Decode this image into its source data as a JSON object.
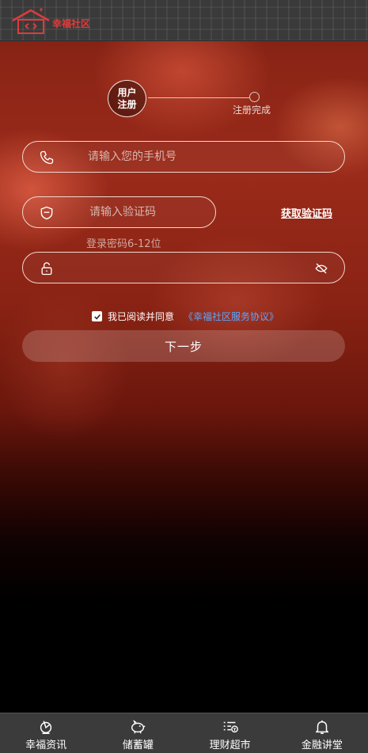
{
  "header": {
    "logo_text": "幸福社区"
  },
  "stepper": {
    "step1_label": "用户注册",
    "step2_label": "注册完成"
  },
  "form": {
    "phone_placeholder": "请输入您的手机号",
    "code_placeholder": "请输入验证码",
    "get_code_label": "获取验证码",
    "password_hint": "登录密码6-12位",
    "agree_text": "我已阅读并同意",
    "agree_link": "《幸福社区服务协议》",
    "agree_checked": true,
    "next_button": "下一步"
  },
  "tabbar": {
    "items": [
      {
        "label": "幸福资讯",
        "icon": "news-icon"
      },
      {
        "label": "储蓄罐",
        "icon": "piggy-bank-icon"
      },
      {
        "label": "理财超市",
        "icon": "finance-list-icon"
      },
      {
        "label": "金融讲堂",
        "icon": "bell-icon"
      }
    ]
  },
  "colors": {
    "accent_link": "#5aa8ff",
    "logo_red": "#e23a3a",
    "tabbar_bg": "#3b3b3b"
  }
}
